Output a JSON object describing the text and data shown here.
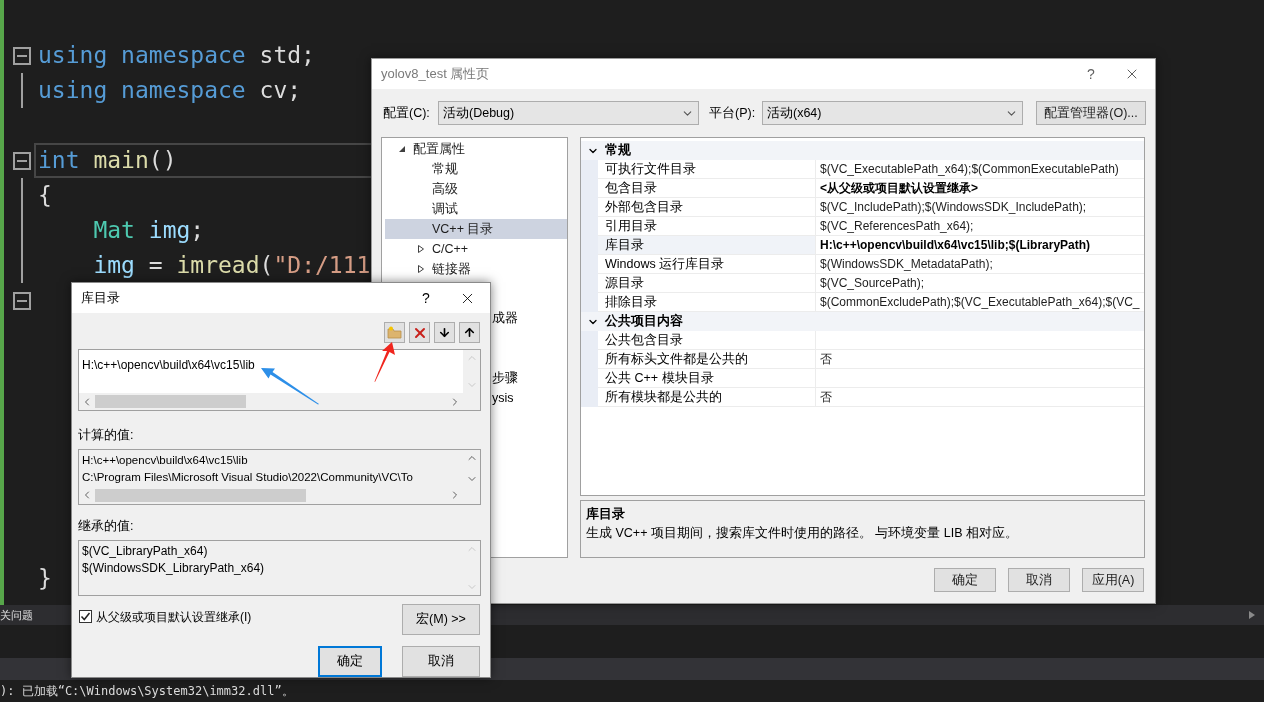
{
  "editor": {
    "blocks": [
      {
        "lines": [
          {
            "fold": true,
            "current": false,
            "tokens": [
              {
                "text": "using",
                "kind": "keyword"
              },
              {
                "text": " namespace",
                "kind": "keyword"
              },
              {
                "text": " std;",
                "kind": "plain"
              }
            ]
          },
          {
            "fold": false,
            "current": false,
            "tokens": [
              {
                "text": "using",
                "kind": "keyword"
              },
              {
                "text": " namespace",
                "kind": "keyword"
              },
              {
                "text": " cv;",
                "kind": "plain"
              }
            ]
          }
        ]
      },
      {
        "lines": [
          {
            "fold": true,
            "current": true,
            "tokens": [
              {
                "text": "int",
                "kind": "keyword"
              },
              {
                "text": " main",
                "kind": "function"
              },
              {
                "text": "()",
                "kind": "plain"
              }
            ]
          },
          {
            "fold": false,
            "current": false,
            "tokens": [
              {
                "text": "{",
                "kind": "plain"
              }
            ]
          },
          {
            "fold": false,
            "current": false,
            "tokens": [
              {
                "text": "    Mat",
                "kind": "type"
              },
              {
                "text": " img",
                "kind": "variable"
              },
              {
                "text": ";",
                "kind": "plain"
              }
            ]
          },
          {
            "fold": false,
            "current": false,
            "tokens": [
              {
                "text": "    img",
                "kind": "variable"
              },
              {
                "text": " = ",
                "kind": "plain"
              },
              {
                "text": "imread",
                "kind": "function"
              },
              {
                "text": "(",
                "kind": "plain"
              },
              {
                "text": "\"D:/111",
                "kind": "string"
              }
            ]
          },
          {
            "fold": true,
            "current": false
          }
        ]
      }
    ],
    "closing_line": {
      "tokens": [
        {
          "text": "}",
          "kind": "plain"
        }
      ]
    }
  },
  "panel": {
    "tab": "关问题",
    "output": "): 已加载“C:\\Windows\\System32\\imm32.dll”。"
  },
  "property_page": {
    "title": "yolov8_test 属性页",
    "help_button": "?",
    "config_label": "配置(C):",
    "config_value": "活动(Debug)",
    "platform_label": "平台(P):",
    "platform_value": "活动(x64)",
    "manager_button": "配置管理器(O)...",
    "tree": [
      {
        "text": "配置属性",
        "kind": "group",
        "expanded": true,
        "selected": false,
        "children": [
          {
            "text": "常规",
            "kind": "leaf",
            "selected": false
          },
          {
            "text": "高级",
            "kind": "leaf",
            "selected": false
          },
          {
            "text": "调试",
            "kind": "leaf",
            "selected": false
          },
          {
            "text": "VC++ 目录",
            "kind": "leaf",
            "selected": true
          },
          {
            "text": "C/C++",
            "kind": "group",
            "expanded": false,
            "selected": false
          },
          {
            "text": "链接器",
            "kind": "group",
            "expanded": false,
            "selected": false
          }
        ]
      }
    ],
    "covered_tree_parts": [
      "成器",
      "步骤",
      "ysis"
    ],
    "sections": [
      {
        "title": "常规",
        "expanded": true,
        "rows": [
          {
            "name": "可执行文件目录",
            "value": "$(VC_ExecutablePath_x64);$(CommonExecutablePath)",
            "bold": false,
            "selected": false
          },
          {
            "name": "包含目录",
            "value": "<从父级或项目默认设置继承>",
            "bold": true,
            "selected": false
          },
          {
            "name": "外部包含目录",
            "value": "$(VC_IncludePath);$(WindowsSDK_IncludePath);",
            "bold": false,
            "selected": false
          },
          {
            "name": "引用目录",
            "value": "$(VC_ReferencesPath_x64);",
            "bold": false,
            "selected": false
          },
          {
            "name": "库目录",
            "value": "H:\\c++\\opencv\\build\\x64\\vc15\\lib;$(LibraryPath)",
            "bold": true,
            "selected": true
          },
          {
            "name": "Windows 运行库目录",
            "value": "$(WindowsSDK_MetadataPath);",
            "bold": false,
            "selected": false
          },
          {
            "name": "源目录",
            "value": "$(VC_SourcePath);",
            "bold": false,
            "selected": false
          },
          {
            "name": "排除目录",
            "value": "$(CommonExcludePath);$(VC_ExecutablePath_x64);$(VC_",
            "bold": false,
            "selected": false
          }
        ]
      },
      {
        "title": "公共项目内容",
        "expanded": true,
        "rows": [
          {
            "name": "公共包含目录",
            "selected": false
          },
          {
            "name": "所有标头文件都是公共的",
            "value": "否",
            "bold": false,
            "selected": false
          },
          {
            "name": "公共 C++ 模块目录",
            "selected": false
          },
          {
            "name": "所有模块都是公共的",
            "value": "否",
            "bold": false,
            "selected": false
          }
        ]
      }
    ],
    "description": {
      "title": "库目录",
      "text": "生成 VC++ 项目期间，搜索库文件时使用的路径。 与环境变量 LIB 相对应。"
    },
    "buttons": [
      "确定",
      "取消",
      "应用(A)"
    ]
  },
  "dialog": {
    "title": "库目录",
    "help_button": "?",
    "entries": [
      "H:\\c++\\opencv\\build\\x64\\vc15\\lib"
    ],
    "computed_label": "计算的值:",
    "computed": [
      "H:\\c++\\opencv\\build\\x64\\vc15\\lib",
      "C:\\Program Files\\Microsoft Visual Studio\\2022\\Community\\VC\\To"
    ],
    "inherited_label": "继承的值:",
    "inherited": [
      "$(VC_LibraryPath_x64)",
      "$(WindowsSDK_LibraryPath_x64)"
    ],
    "inherit_checkbox": {
      "label": "从父级或项目默认设置继承(I)",
      "checked": true
    },
    "macro_button": "宏(M) >>",
    "ok_button": "确定",
    "cancel_button": "取消"
  }
}
